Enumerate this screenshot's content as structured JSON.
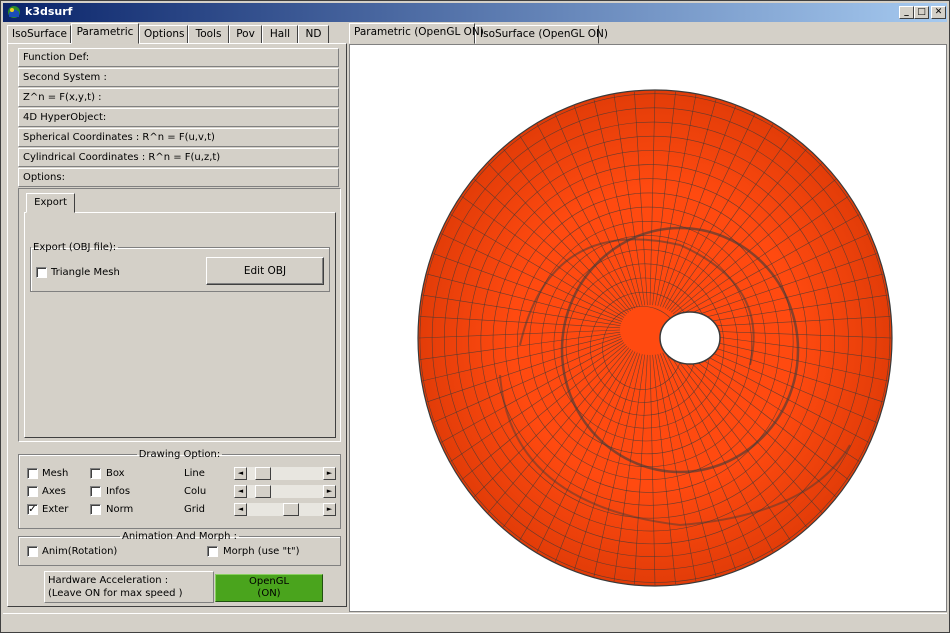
{
  "window": {
    "title": "k3dsurf",
    "minimize": "_",
    "maximize": "□",
    "close": "✕"
  },
  "left_tabs": [
    "IsoSurface",
    "Parametric",
    "Options",
    "Tools",
    "Pov",
    "Hall",
    "ND"
  ],
  "left_tabs_active": "Parametric",
  "accordion": [
    "Function Def:",
    "Second System :",
    "Z^n = F(x,y,t) :",
    "4D HyperObject:",
    "Spherical Coordinates : R^n = F(u,v,t)",
    "Cylindrical Coordinates : R^n = F(u,z,t)",
    "Options:"
  ],
  "options": {
    "tab_label": "Export",
    "export_group": {
      "legend": "Export (OBJ file):",
      "triangle_mesh_label": "Triangle Mesh",
      "triangle_mesh_checked": false,
      "edit_obj_label": "Edit OBJ"
    }
  },
  "drawing": {
    "legend": "Drawing Option:",
    "checkboxes": [
      {
        "label": "Mesh",
        "checked": false
      },
      {
        "label": "Box",
        "checked": false
      },
      {
        "label": "Axes",
        "checked": false
      },
      {
        "label": "Infos",
        "checked": false
      },
      {
        "label": "Exter",
        "checked": true
      },
      {
        "label": "Norm",
        "checked": false
      }
    ],
    "sliders": [
      {
        "label": "Line",
        "value": 0.13
      },
      {
        "label": "Colu",
        "value": 0.13
      },
      {
        "label": "Grid",
        "value": 0.6
      }
    ],
    "arrow_left": "◄",
    "arrow_right": "►"
  },
  "animation": {
    "legend": "Animation And Morph :",
    "anim_label": "Anim(Rotation)",
    "anim_checked": false,
    "morph_label": "Morph (use \"t\")",
    "morph_checked": false
  },
  "hardware": {
    "label_line1": "Hardware Acceleration :",
    "label_line2": "(Leave ON for max speed )",
    "opengl_line1": "OpenGL",
    "opengl_line2": "(ON)",
    "opengl_color": "#4aa41d"
  },
  "view_tabs": [
    "Parametric (OpenGL ON)",
    "IsoSurface (OpenGL ON)"
  ],
  "view_tabs_active": "Parametric (OpenGL ON)",
  "surface": {
    "fill_color": "#ff4a10",
    "mesh_color": "#3a3a3a",
    "background": "#ffffff"
  }
}
